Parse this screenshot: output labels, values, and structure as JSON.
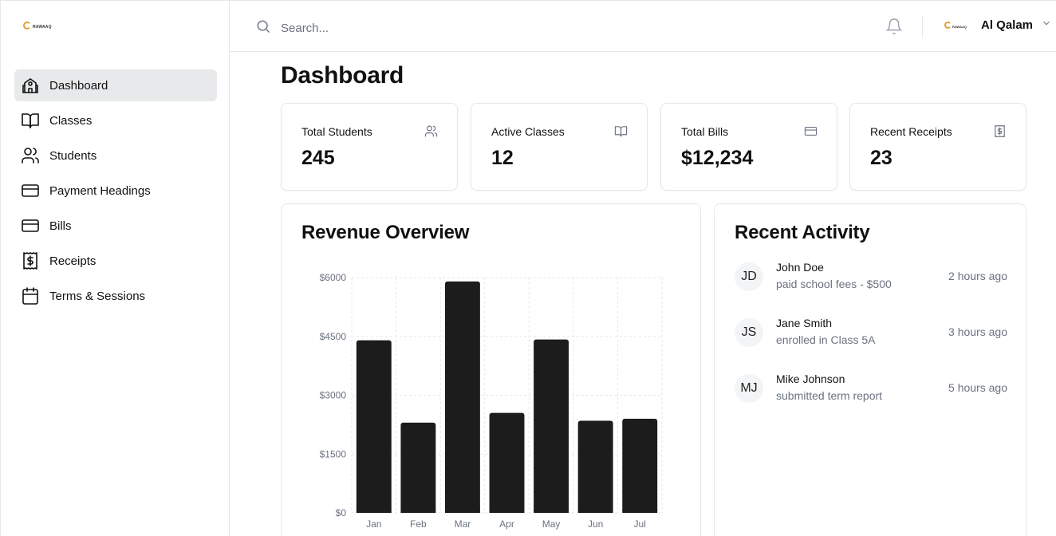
{
  "brand": {
    "logo_text": "RAWAAQ"
  },
  "sidebar": {
    "items": [
      {
        "label": "Dashboard",
        "icon": "school-icon",
        "active": true
      },
      {
        "label": "Classes",
        "icon": "book-open-icon"
      },
      {
        "label": "Students",
        "icon": "users-icon"
      },
      {
        "label": "Payment Headings",
        "icon": "credit-card-icon"
      },
      {
        "label": "Bills",
        "icon": "credit-card-icon"
      },
      {
        "label": "Receipts",
        "icon": "receipt-icon"
      },
      {
        "label": "Terms & Sessions",
        "icon": "calendar-icon"
      }
    ]
  },
  "header": {
    "search_placeholder": "Search...",
    "user_name": "Al Qalam",
    "user_logo_text": "RAWAAQ"
  },
  "page": {
    "title": "Dashboard"
  },
  "stats": [
    {
      "label": "Total Students",
      "value": "245",
      "icon": "users-icon"
    },
    {
      "label": "Active Classes",
      "value": "12",
      "icon": "book-open-icon"
    },
    {
      "label": "Total Bills",
      "value": "$12,234",
      "icon": "credit-card-icon"
    },
    {
      "label": "Recent Receipts",
      "value": "23",
      "icon": "receipt-icon"
    }
  ],
  "revenue": {
    "title": "Revenue Overview"
  },
  "activity": {
    "title": "Recent Activity",
    "items": [
      {
        "initials": "JD",
        "name": "John Doe",
        "action": "paid school fees - $500",
        "time": "2 hours ago"
      },
      {
        "initials": "JS",
        "name": "Jane Smith",
        "action": "enrolled in Class 5A",
        "time": "3 hours ago"
      },
      {
        "initials": "MJ",
        "name": "Mike Johnson",
        "action": "submitted term report",
        "time": "5 hours ago"
      }
    ]
  },
  "chart_data": {
    "type": "bar",
    "title": "Revenue Overview",
    "categories": [
      "Jan",
      "Feb",
      "Mar",
      "Apr",
      "May",
      "Jun",
      "Jul"
    ],
    "values": [
      4400,
      2300,
      5900,
      2550,
      4420,
      2350,
      2400
    ],
    "ylim": [
      0,
      6000
    ],
    "yticks": [
      0,
      1500,
      3000,
      4500,
      6000
    ],
    "ytick_labels": [
      "$0",
      "$1500",
      "$3000",
      "$4500",
      "$6000"
    ],
    "grid": true,
    "bar_color": "#1c1c1c"
  }
}
